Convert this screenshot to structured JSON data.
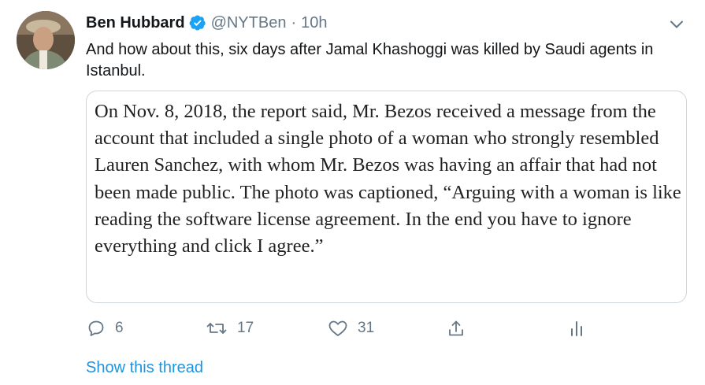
{
  "tweet": {
    "author_name": "Ben Hubbard",
    "handle": "@NYTBen",
    "separator": "·",
    "time": "10h",
    "text": "And how about this, six days after Jamal Khashoggi was killed by Saudi agents in Istanbul.",
    "quote_image_text": "On Nov. 8, 2018, the report said, Mr. Bezos received a message from the account that included a single photo of a woman who strongly resembled Lauren Sanchez, with whom Mr. Bezos was having an affair that had not been made public. The photo was captioned, “Arguing with a woman is like reading the software license agreement. In the end you have to ignore everything and click I agree.”"
  },
  "actions": {
    "reply_count": "6",
    "retweet_count": "17",
    "like_count": "31"
  },
  "show_thread_label": "Show this thread",
  "icons": {
    "avatar": "avatar",
    "verified": "verified-badge-icon",
    "more": "chevron-down-icon",
    "reply": "reply-icon",
    "retweet": "retweet-icon",
    "like": "heart-icon",
    "share": "share-icon",
    "analytics": "analytics-icon"
  },
  "colors": {
    "accent": "#1b95e0",
    "verified": "#1da1f2",
    "muted": "#657786",
    "border": "#ccd6dd"
  }
}
